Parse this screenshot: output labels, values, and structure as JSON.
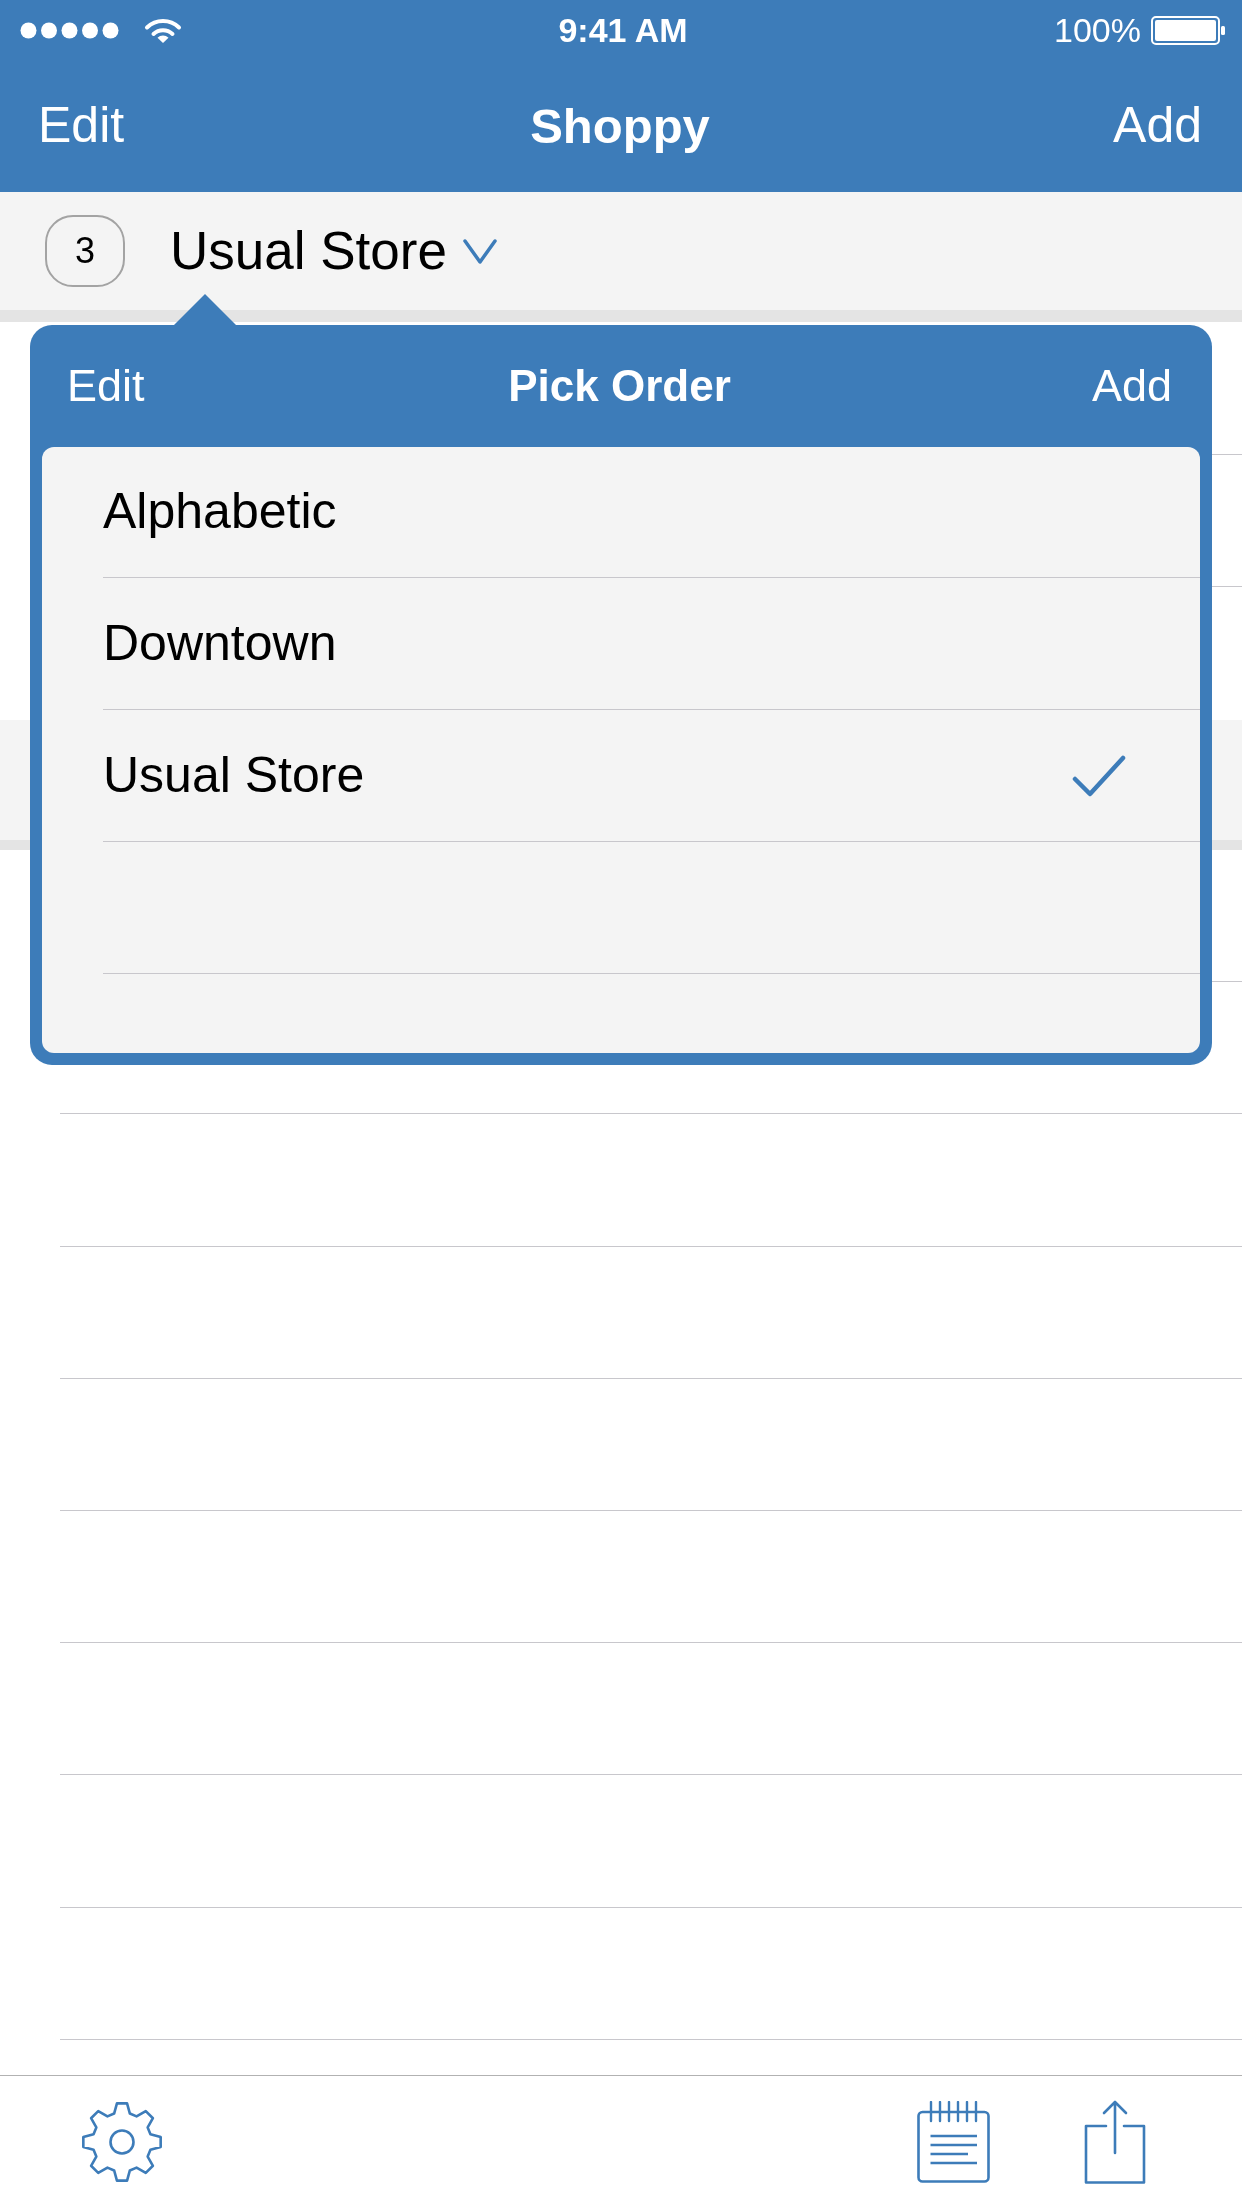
{
  "status_bar": {
    "time": "9:41 AM",
    "battery": "100%"
  },
  "nav_bar": {
    "left_button": "Edit",
    "title": "Shoppy",
    "right_button": "Add"
  },
  "store_header": {
    "count": "3",
    "store": "Usual Store"
  },
  "popover": {
    "left_button": "Edit",
    "title": "Pick Order",
    "right_button": "Add",
    "items": [
      {
        "label": "Alphabetic",
        "selected": false
      },
      {
        "label": "Downtown",
        "selected": false
      },
      {
        "label": "Usual Store",
        "selected": true
      }
    ]
  }
}
